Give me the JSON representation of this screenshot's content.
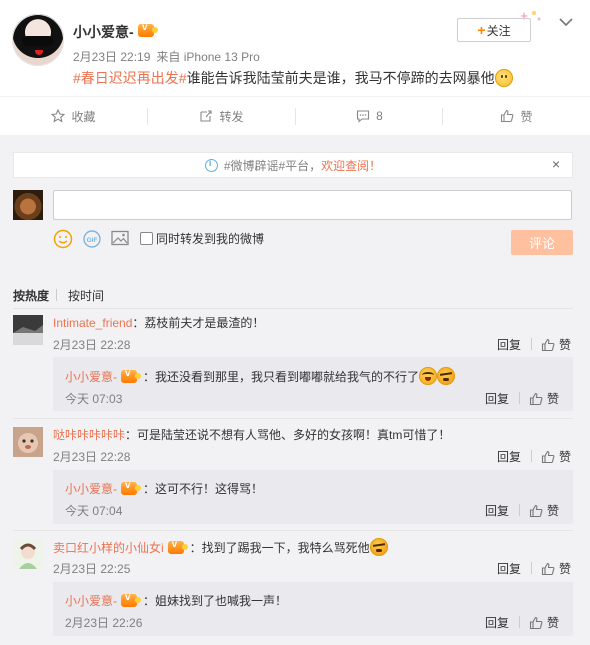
{
  "post": {
    "author": "小小爱意-",
    "timestamp": "2月23日 22:19",
    "source": "来自 iPhone 13 Pro",
    "topic": "#春日迟迟再出发#",
    "text": "谁能告诉我陆莹前夫是谁，我马不停蹄的去网暴他",
    "follow_label": "关注",
    "follow_plus": "+"
  },
  "actions": {
    "favorite": "收藏",
    "repost": "转发",
    "comment_count": "8",
    "like": "赞"
  },
  "notice": {
    "text": "#微博辟谣#平台，",
    "link": "欢迎查阅！",
    "close": "×"
  },
  "composer": {
    "placeholder": "",
    "repost_label": "同时转发到我的微博",
    "submit_label": "评论"
  },
  "sort": {
    "hot": "按热度",
    "time": "按时间"
  },
  "comments": [
    {
      "user": "Intimate_friend",
      "text": "：荔枝前夫才是最渣的！",
      "time": "2月23日 22:28",
      "reply": "回复",
      "like": "赞",
      "sub": {
        "user": "小小爱意-",
        "text": "：我还没看到那里，我只看到嘟嘟就给我气的不行了",
        "time": "今天 07:03",
        "reply": "回复",
        "like": "赞"
      }
    },
    {
      "user": "哒咔咔咔咔咔",
      "text": "：可是陆莹还说不想有人骂他、多好的女孩啊！真tm可惜了！",
      "time": "2月23日 22:28",
      "reply": "回复",
      "like": "赞",
      "sub": {
        "user": "小小爱意-",
        "text": "：这可不行！这得骂！",
        "time": "今天 07:04",
        "reply": "回复",
        "like": "赞"
      }
    },
    {
      "user": "卖口红小样的小仙女i",
      "text": "：找到了踢我一下，我特么骂死他",
      "time": "2月23日 22:25",
      "reply": "回复",
      "like": "赞",
      "sub": {
        "user": "小小爱意-",
        "text": "：姐妹找到了也喊我一声！",
        "time": "2月23日 22:26",
        "reply": "回复",
        "like": "赞"
      }
    }
  ],
  "colors": {
    "accent": "#eb7350",
    "orange": "#ff8200",
    "submit_disabled": "#ffc09f",
    "comment_bg": "#f2f2f5",
    "sub_bg": "#e9e9ee"
  }
}
